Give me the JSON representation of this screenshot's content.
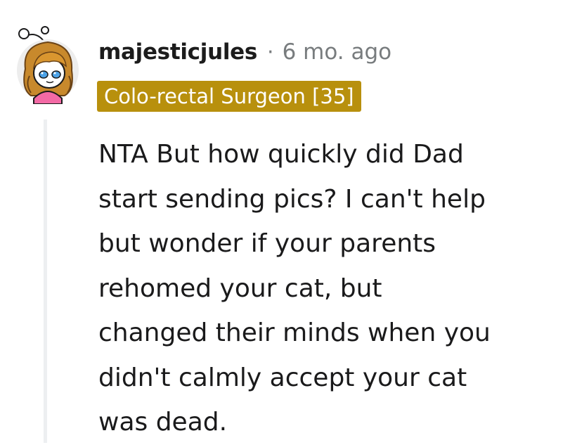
{
  "comment": {
    "username": "majesticjules",
    "separator": "·",
    "timestamp": "6 mo. ago",
    "flair": "Colo-rectal Surgeon [35]",
    "avatar_icon": "cartoon-avatar-icon",
    "body_lines": [
      "NTA But how quickly did Dad",
      "start sending pics? I can't help",
      "but wonder if your parents",
      "rehomed your cat, but",
      "changed their minds when you",
      "didn't calmly accept your cat",
      "was dead."
    ]
  },
  "colors": {
    "flair_background": "#b8900d",
    "flair_text": "#ffffff",
    "meta_text": "#787c7e",
    "threadline": "#edeff1"
  }
}
